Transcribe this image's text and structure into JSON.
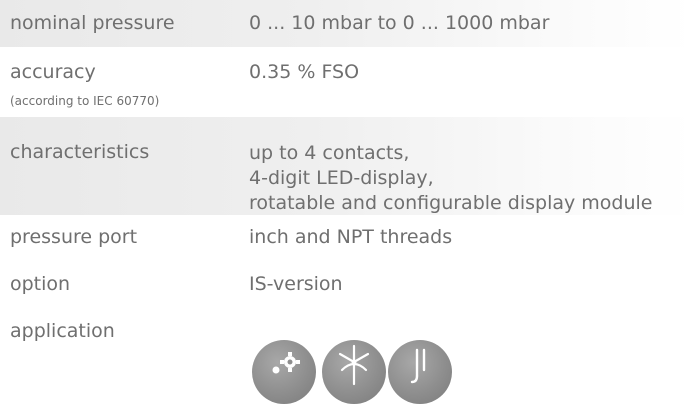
{
  "specs": [
    {
      "label": "nominal pressure",
      "value": "0 ... 10 mbar to 0 ... 1000 mbar"
    },
    {
      "label": "accuracy",
      "sublabel": "(according to IEC 60770)",
      "value": "0.35 % FSO"
    },
    {
      "label": "characteristics",
      "values": [
        "up to 4 contacts,",
        "4-digit LED-display,",
        "rotatable and configurable display module"
      ]
    },
    {
      "label": "pressure port",
      "value": "inch and NPT threads"
    },
    {
      "label": "option",
      "value": "IS-version"
    },
    {
      "label": "application",
      "icons": [
        "gear-industry-icon",
        "wind-turbine-icon",
        "tank-level-icon"
      ]
    }
  ],
  "colors": {
    "text": "#6f6f6f",
    "row_shade": "#ececec",
    "icon_bg": "#8e8e8e",
    "icon_fg": "#ffffff"
  }
}
